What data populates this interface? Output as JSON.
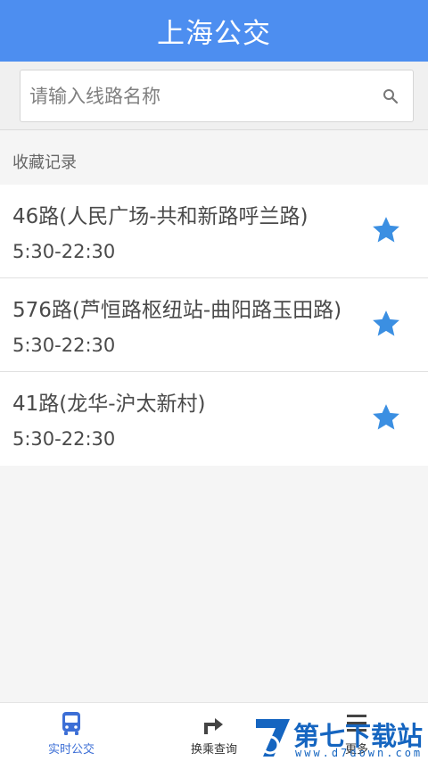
{
  "app": {
    "title": "上海公交"
  },
  "search": {
    "placeholder": "请输入线路名称",
    "value": ""
  },
  "favorites": {
    "heading": "收藏记录",
    "items": [
      {
        "name": "46路(人民广场-共和新路呼兰路)",
        "time": "5:30-22:30",
        "starred": true
      },
      {
        "name": "576路(芦恒路枢纽站-曲阳路玉田路)",
        "time": "5:30-22:30",
        "starred": true
      },
      {
        "name": "41路(龙华-沪太新村)",
        "time": "5:30-22:30",
        "starred": true
      }
    ]
  },
  "bottom_nav": {
    "items": [
      {
        "label": "实时公交",
        "icon": "bus-icon",
        "active": true
      },
      {
        "label": "换乘查询",
        "icon": "transfer-arrow-icon",
        "active": false
      },
      {
        "label": "更多",
        "icon": "menu-icon",
        "active": false
      }
    ]
  },
  "watermark": {
    "main": "第七下载站",
    "sub": "www.d7down.com"
  },
  "colors": {
    "primary": "#4d8ef0",
    "star": "#3b8fe2",
    "active_nav": "#3d6fd6",
    "watermark": "#1565c0"
  }
}
